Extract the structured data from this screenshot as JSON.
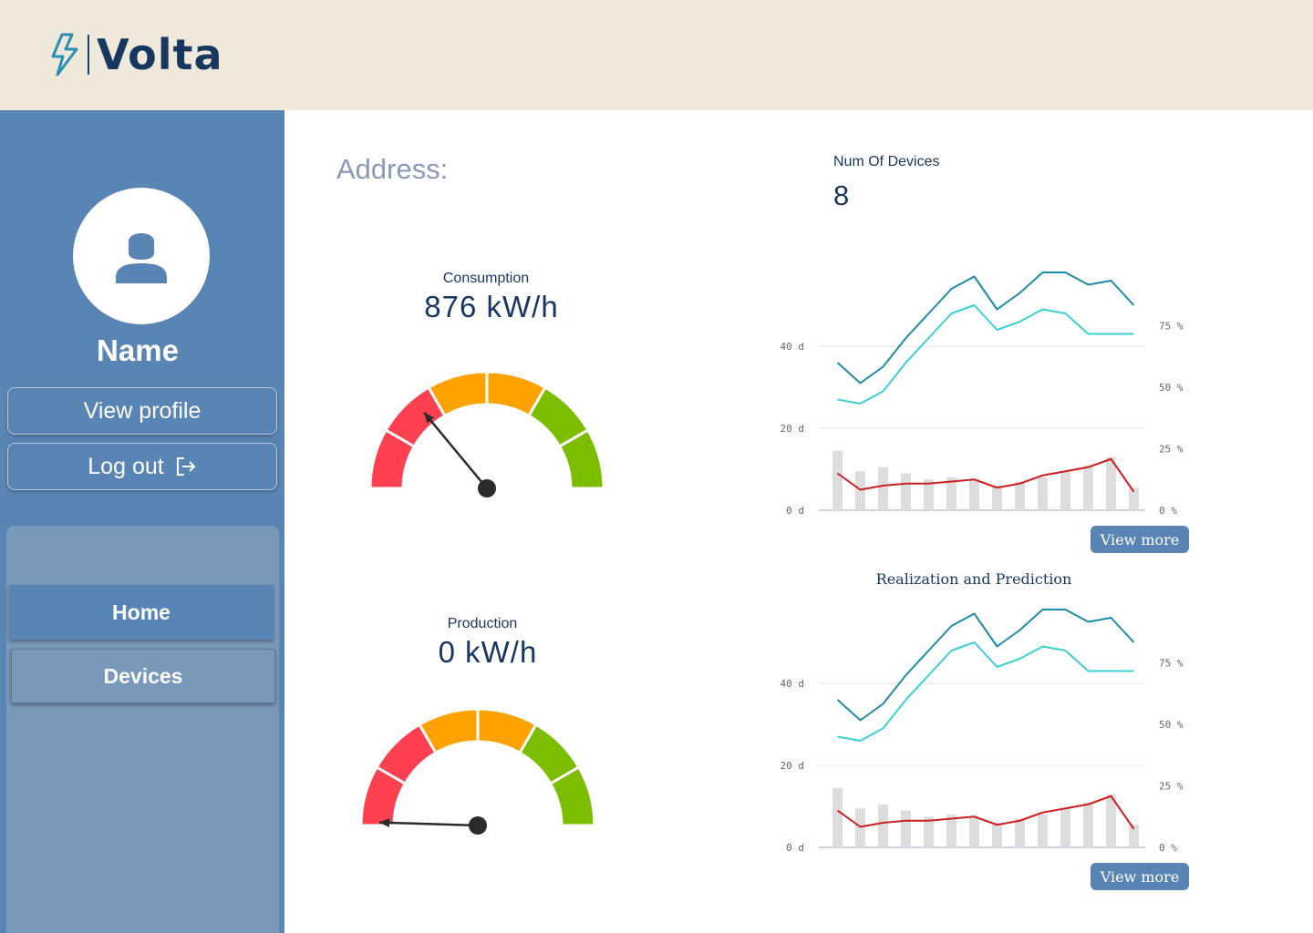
{
  "app": {
    "logo_text": "Volta"
  },
  "sidebar": {
    "user_name": "Name",
    "view_profile_label": "View profile",
    "logout_label": "Log out",
    "nav": [
      {
        "label": "Home"
      },
      {
        "label": "Devices"
      }
    ]
  },
  "main": {
    "address_label": "Address:",
    "num_devices_label": "Num Of Devices",
    "num_devices_value": "8"
  },
  "gauges": [
    {
      "title": "Consumption",
      "value_text": "876 kW/h",
      "needle_level": 0.28
    },
    {
      "title": "Production",
      "value_text": "0 kW/h",
      "needle_level": 0.01
    }
  ],
  "colors": {
    "red": "#fe4050",
    "orange": "#fea200",
    "green": "#7cbd00",
    "dark_blue": "#17375f",
    "sidebar": "#5885b3"
  },
  "chart_data": [
    {
      "type": "line",
      "title": "",
      "y_left_ticks": [
        "0 d",
        "20 d",
        "40 d"
      ],
      "y_right_ticks": [
        "0 %",
        "25 %",
        "50 %",
        "75 %"
      ],
      "ylim_left": [
        0,
        60
      ],
      "ylim_right": [
        0,
        100
      ],
      "view_more_label": "View more",
      "series": [
        {
          "axis": "left",
          "color": "#1d8aa8",
          "values": [
            36,
            31,
            35,
            42,
            48,
            54,
            57,
            49,
            53,
            58,
            58,
            55,
            56,
            50
          ]
        },
        {
          "axis": "left",
          "color": "#3ccfd6",
          "values": [
            27,
            26,
            29,
            36,
            42,
            48,
            50,
            44,
            46,
            49,
            48,
            43,
            43,
            43
          ]
        },
        {
          "axis": "left",
          "color": "#cc1f1f",
          "values": [
            9,
            5,
            6,
            6.5,
            6.5,
            7,
            7.5,
            5.5,
            6.5,
            8.5,
            9.5,
            10.5,
            12.5,
            4.5
          ]
        },
        {
          "axis": "left",
          "type": "bar",
          "color": "#dddddd",
          "values": [
            14.5,
            9.5,
            10.5,
            9,
            7.5,
            8,
            7.5,
            6,
            7,
            8,
            9.5,
            11,
            13,
            5.5
          ]
        }
      ]
    },
    {
      "type": "line",
      "title": "Realization and Prediction",
      "y_left_ticks": [
        "0 d",
        "20 d",
        "40 d"
      ],
      "y_right_ticks": [
        "0 %",
        "25 %",
        "50 %",
        "75 %"
      ],
      "ylim_left": [
        0,
        60
      ],
      "ylim_right": [
        0,
        100
      ],
      "view_more_label": "View more",
      "series": [
        {
          "axis": "left",
          "color": "#1d8aa8",
          "values": [
            36,
            31,
            35,
            42,
            48,
            54,
            57,
            49,
            53,
            58,
            58,
            55,
            56,
            50
          ]
        },
        {
          "axis": "left",
          "color": "#3ccfd6",
          "values": [
            27,
            26,
            29,
            36,
            42,
            48,
            50,
            44,
            46,
            49,
            48,
            43,
            43,
            43
          ]
        },
        {
          "axis": "left",
          "color": "#cc1f1f",
          "values": [
            9,
            5,
            6,
            6.5,
            6.5,
            7,
            7.5,
            5.5,
            6.5,
            8.5,
            9.5,
            10.5,
            12.5,
            4.5
          ]
        },
        {
          "axis": "left",
          "type": "bar",
          "color": "#dddddd",
          "values": [
            14.5,
            9.5,
            10.5,
            9,
            7.5,
            8,
            7.5,
            6,
            7,
            8,
            9.5,
            11,
            13,
            5.5
          ]
        }
      ]
    }
  ]
}
